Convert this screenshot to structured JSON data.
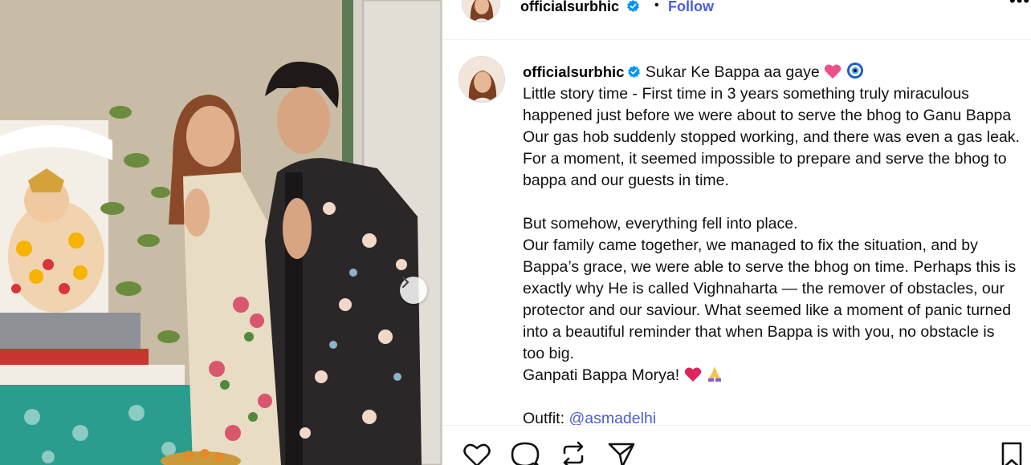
{
  "post": {
    "username": "officialsurbhic",
    "follow_label": "Follow",
    "dot": "•",
    "more_label": "•••"
  },
  "caption": {
    "username": "officialsurbhic",
    "headline": "Sukar Ke Bappa aa gaye",
    "para1": "Little story time - First time in 3 years something truly miraculous happened just before we were about to serve the bhog to Ganu Bappa Our gas hob suddenly stopped working, and there was even a gas leak. For a moment, it seemed impossible to prepare and serve the bhog to bappa and our guests in time.",
    "line2": "But somehow, everything fell into place.",
    "line3": "Our family came together, we managed to fix the situation, and by Bappa’s grace, we were able to serve the bhog on time. Perhaps this is exactly why He is called Vighnaharta — the remover of obstacles, our protector and our saviour. What seemed like a moment of panic turned into a beautiful reminder that when Bappa is with you, no obstacle is too big.",
    "line4": "Ganpati Bappa Morya!",
    "outfit_label": "Outfit:",
    "outfit_mention": "@asmadelhi"
  },
  "icons": {
    "verified": "verified-badge-icon",
    "heart_emoji": "pink-heart-emoji",
    "evil_eye_emoji": "evil-eye-emoji",
    "heart2_emoji": "heart-emoji",
    "pray_emoji": "folded-hands-emoji",
    "like": "heart-outline-icon",
    "comment": "comment-bubble-icon",
    "share": "repost-icon",
    "send": "paper-plane-icon",
    "save": "bookmark-icon",
    "next": "chevron-right-icon"
  },
  "colors": {
    "link": "#4a5ed6",
    "verified": "#0095f6",
    "text": "#111111",
    "heart": "#ec4f8a"
  }
}
